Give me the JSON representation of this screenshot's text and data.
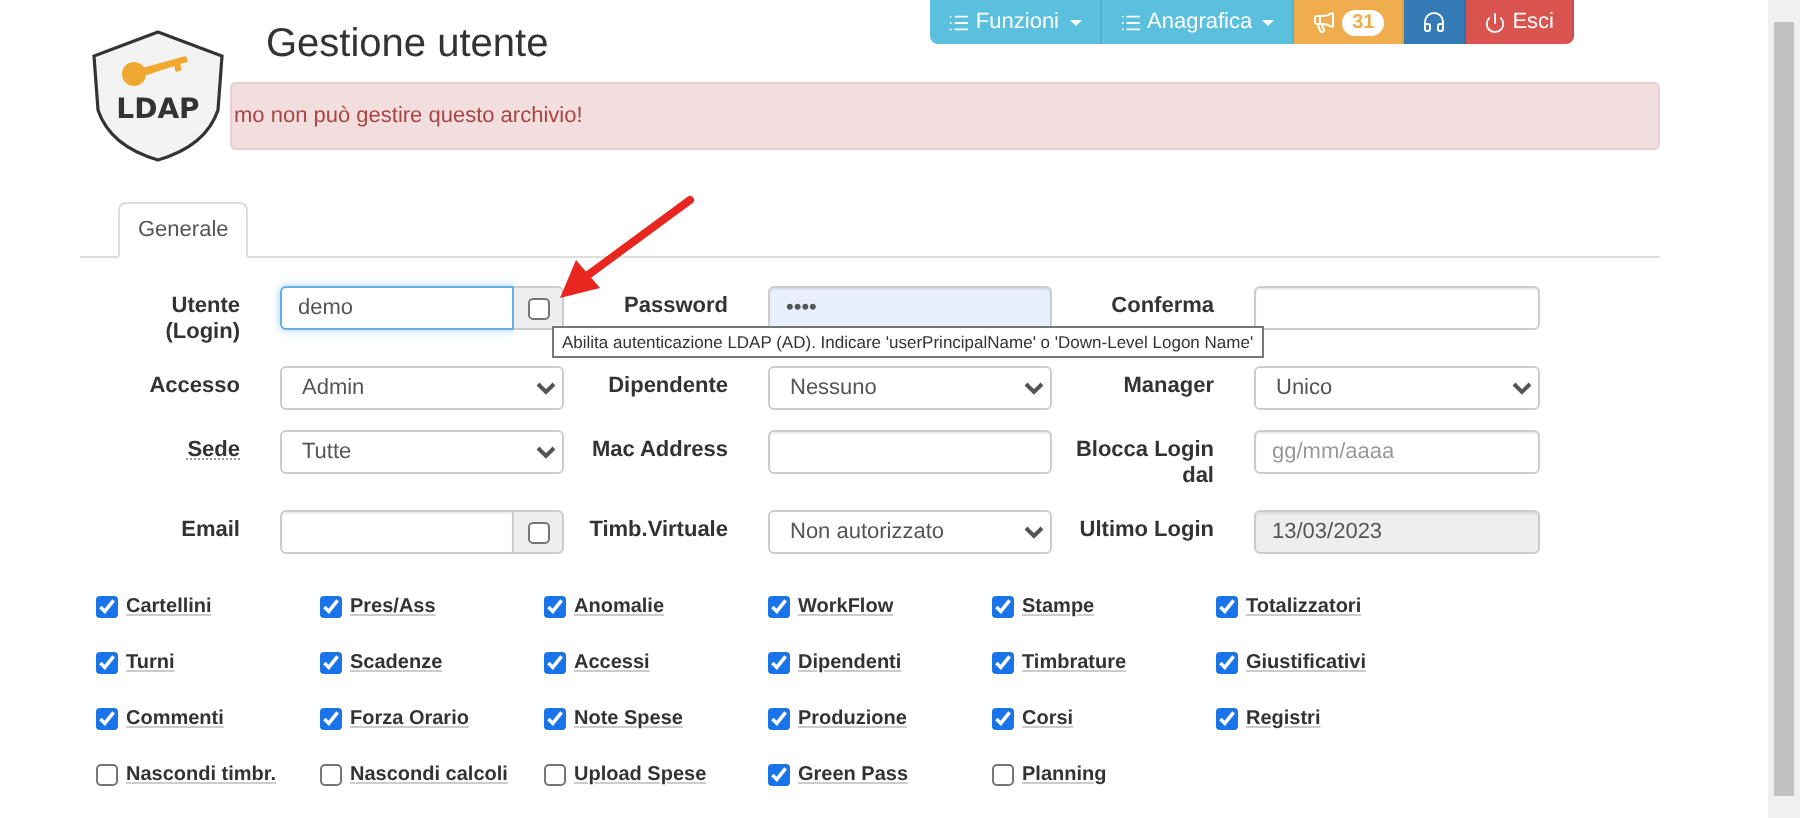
{
  "nav": [
    {
      "kind": "menu",
      "label": "Funzioni"
    },
    {
      "kind": "menu",
      "label": "Anagrafica"
    },
    {
      "kind": "notifications",
      "badge": "31"
    },
    {
      "kind": "support"
    },
    {
      "kind": "logout",
      "label": "Esci"
    }
  ],
  "logo": {
    "text": "LDAP"
  },
  "title": "Gestione utente",
  "alert": "mo non può gestire questo archivio!",
  "tabs": [
    {
      "label": "Generale",
      "selected": true
    }
  ],
  "fields": [
    {
      "label": "Utente (Login)",
      "kind": "text",
      "value": "demo",
      "focused": true,
      "autofilled": false,
      "underlined": false,
      "addon": {
        "checked": false
      }
    },
    {
      "label": "Password",
      "kind": "text",
      "value": "••••",
      "focused": false,
      "autofilled": true,
      "underlined": false
    },
    {
      "label": "Conferma",
      "kind": "text",
      "focused": false,
      "autofilled": false,
      "underlined": false
    },
    {
      "label": "Accesso",
      "kind": "select",
      "value": "Admin",
      "underlined": false
    },
    {
      "label": "Dipendente",
      "kind": "select",
      "value": "Nessuno",
      "underlined": false
    },
    {
      "label": "Manager",
      "kind": "select",
      "value": "Unico",
      "underlined": false
    },
    {
      "label": "Sede",
      "kind": "select",
      "value": "Tutte",
      "underlined": true
    },
    {
      "label": "Mac Address",
      "kind": "text",
      "focused": false,
      "autofilled": false,
      "underlined": false
    },
    {
      "label": "Blocca Login dal",
      "kind": "text",
      "placeholder": "gg/mm/aaaa",
      "focused": false,
      "autofilled": false,
      "underlined": false
    },
    {
      "label": "Email",
      "kind": "text",
      "focused": false,
      "autofilled": false,
      "underlined": false,
      "addon": {
        "checked": false
      }
    },
    {
      "label": "Timb.Virtuale",
      "kind": "select",
      "value": "Non autorizzato",
      "underlined": false
    },
    {
      "label": "Ultimo Login",
      "kind": "readonly",
      "value": "13/03/2023",
      "focused": false,
      "autofilled": false,
      "underlined": false
    }
  ],
  "tooltip": "Abilita autenticazione LDAP (AD). Indicare 'userPrincipalName' o 'Down-Level Logon Name'",
  "permissions": [
    {
      "label": "Cartellini",
      "checked": true
    },
    {
      "label": "Pres/Ass",
      "checked": true
    },
    {
      "label": "Anomalie",
      "checked": true
    },
    {
      "label": "WorkFlow",
      "checked": true
    },
    {
      "label": "Stampe",
      "checked": true
    },
    {
      "label": "Totalizzatori",
      "checked": true
    },
    {
      "label": "Turni",
      "checked": true
    },
    {
      "label": "Scadenze",
      "checked": true
    },
    {
      "label": "Accessi",
      "checked": true
    },
    {
      "label": "Dipendenti",
      "checked": true
    },
    {
      "label": "Timbrature",
      "checked": true
    },
    {
      "label": "Giustificativi",
      "checked": true
    },
    {
      "label": "Commenti",
      "checked": true
    },
    {
      "label": "Forza Orario",
      "checked": true
    },
    {
      "label": "Note Spese",
      "checked": true
    },
    {
      "label": "Produzione",
      "checked": true
    },
    {
      "label": "Corsi",
      "checked": true
    },
    {
      "label": "Registri",
      "checked": true
    },
    {
      "label": "Nascondi timbr.",
      "checked": false
    },
    {
      "label": "Nascondi calcoli",
      "checked": false
    },
    {
      "label": "Upload Spese",
      "checked": false
    },
    {
      "label": "Green Pass",
      "checked": true
    },
    {
      "label": "Planning",
      "checked": false
    }
  ]
}
